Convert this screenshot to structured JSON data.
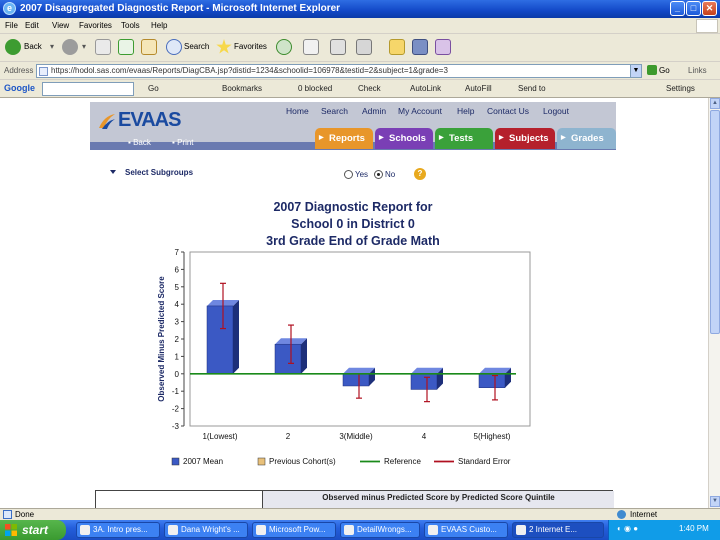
{
  "window": {
    "title": "2007 Disaggregated Diagnostic Report - Microsoft Internet Explorer"
  },
  "menu": [
    "File",
    "Edit",
    "View",
    "Favorites",
    "Tools",
    "Help"
  ],
  "toolbar": {
    "back_label": "Back",
    "search_label": "Search",
    "favorites_label": "Favorites"
  },
  "address": {
    "label": "Address",
    "url": "https://hodol.sas.com/evaas/Reports/DiagCBA.jsp?distid=1234&schoolid=106978&testid=2&subject=1&grade=3",
    "go_label": "Go",
    "links_label": "Links"
  },
  "googlebar": {
    "logo": "Google",
    "items": [
      "Go",
      "Bookmarks",
      "0 blocked",
      "Check",
      "AutoLink",
      "AutoFill",
      "Send to"
    ],
    "settings": "Settings"
  },
  "evaas": {
    "logo": "EVAAS",
    "topnav": [
      "Home",
      "Search",
      "Admin",
      "My Account",
      "Help",
      "Contact Us",
      "Logout"
    ],
    "subnav": [
      "Back",
      "Print"
    ],
    "tabs": [
      {
        "label": "Reports",
        "color": "#e8962a"
      },
      {
        "label": "Schools",
        "color": "#7a3fb5"
      },
      {
        "label": "Tests",
        "color": "#3aa13a"
      },
      {
        "label": "Subjects",
        "color": "#b5202c"
      },
      {
        "label": "Grades",
        "color": "#8eb4cf"
      }
    ]
  },
  "subgroups": {
    "label": "Select Subgroups",
    "yes": "Yes",
    "no": "No",
    "selected": "No"
  },
  "report": {
    "title_lines": [
      "2007 Diagnostic Report for",
      "School 0 in District 0",
      "3rd Grade End of Grade Math"
    ]
  },
  "chart_data": {
    "type": "bar",
    "ylabel": "Observed Minus Predicted Score",
    "xlabel": "",
    "ylim": [
      -3,
      7
    ],
    "yticks": [
      7,
      6,
      5,
      4,
      3,
      2,
      1,
      0,
      -1,
      -2,
      -3
    ],
    "categories": [
      "1(Lowest)",
      "2",
      "3(Middle)",
      "4",
      "5(Highest)"
    ],
    "series": [
      {
        "name": "2007 Mean",
        "values": [
          3.9,
          1.7,
          -0.7,
          -0.9,
          -0.8
        ],
        "color": "#3b59c4"
      }
    ],
    "standard_error": [
      1.3,
      1.1,
      0.7,
      0.7,
      0.7
    ],
    "reference": 0,
    "legend": [
      {
        "label": "2007 Mean",
        "kind": "box",
        "color": "#3b59c4"
      },
      {
        "label": "Previous Cohort(s)",
        "kind": "box",
        "color": "#e8c07a"
      },
      {
        "label": "Reference",
        "kind": "line",
        "color": "#1a8a1a"
      },
      {
        "label": "Standard Error",
        "kind": "line",
        "color": "#b01020"
      }
    ],
    "legend_position": "bottom",
    "grid": false,
    "colors": {
      "bar": "#3b59c4",
      "error": "#b01020",
      "reference": "#1a8a1a",
      "background": "#ffffff"
    }
  },
  "table_stub": {
    "header": "Observed minus Predicted Score by Predicted Score Quintile"
  },
  "status": {
    "text": "Done",
    "zone": "Internet"
  },
  "taskbar": {
    "start": "start",
    "tasks": [
      "3A. Intro pres...",
      "Dana Wright's ...",
      "Microsoft Pow...",
      "DetailWrongs...",
      "EVAAS Custo...",
      "2 Internet E..."
    ],
    "clock": "1:40 PM"
  }
}
